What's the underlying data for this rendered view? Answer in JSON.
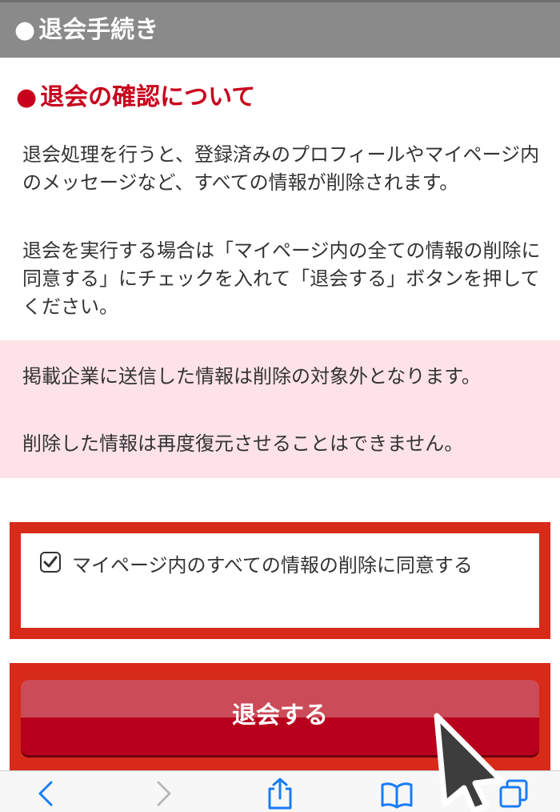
{
  "header": {
    "title": "退会手続き"
  },
  "section": {
    "title": "退会の確認について"
  },
  "description": {
    "p1": "退会処理を行うと、登録済みのプロフィールやマイページ内のメッセージなど、すべての情報が削除されます。",
    "p2": "退会を実行する場合は「マイページ内の全ての情報の削除に同意する」にチェックを入れて「退会する」ボタンを押してください。"
  },
  "notice": {
    "line1": "掲載企業に送信した情報は削除の対象外となります。",
    "line2": "削除した情報は再度復元させることはできません。"
  },
  "agree": {
    "label": "マイページ内のすべての情報の削除に同意する",
    "checked": true
  },
  "withdraw_button": {
    "label": "退会する"
  },
  "colors": {
    "accent_red": "#c8001c",
    "highlight_frame": "#d72a18",
    "notice_bg": "#fde3e8",
    "header_bg": "#8a8a8a",
    "toolbar_icon": "#1a7cf5"
  },
  "toolbar": {
    "icons": [
      "back-icon",
      "forward-icon",
      "share-icon",
      "bookmarks-icon",
      "tabs-icon"
    ]
  }
}
